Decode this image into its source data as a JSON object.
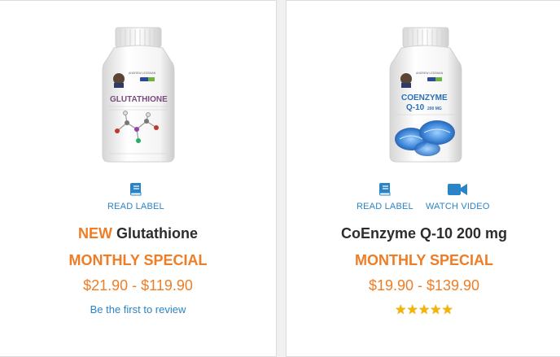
{
  "products": [
    {
      "bottle_label": "GLUTATHIONE",
      "brand": "ANDREW LESSMAN",
      "badge": "PRO",
      "read_label": "READ LABEL",
      "name_prefix": "NEW",
      "name": "Glutathione",
      "special": "MONTHLY SPECIAL",
      "price": "$21.90 - $119.90",
      "review_text": "Be the first to review",
      "accent": "#ef7d25",
      "link_color": "#2a84c6"
    },
    {
      "bottle_label_1": "COENZYME",
      "bottle_label_2": "Q-10",
      "bottle_label_3": "200 MG",
      "brand": "ANDREW LESSMAN",
      "badge": "PRO",
      "read_label": "READ LABEL",
      "watch_video": "WATCH VIDEO",
      "name": "CoEnzyme Q-10 200 mg",
      "special": "MONTHLY SPECIAL",
      "price": "$19.90 - $139.90",
      "rating": {
        "stars": 5,
        "max": 5,
        "display": "★★★★★"
      }
    }
  ],
  "icons": {
    "label": "book-icon",
    "video": "video-camera-icon",
    "star": "star-icon"
  }
}
